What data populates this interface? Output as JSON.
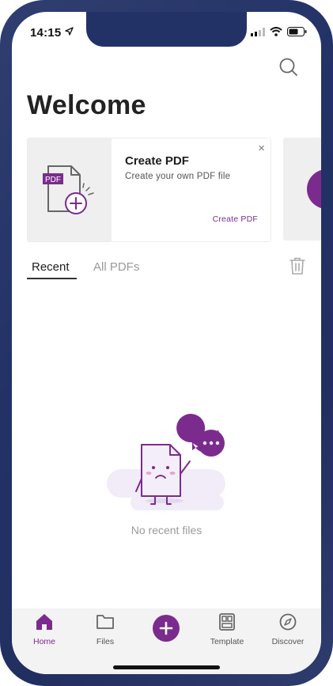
{
  "status": {
    "time": "14:15"
  },
  "page": {
    "title": "Welcome"
  },
  "card": {
    "title": "Create PDF",
    "subtitle": "Create your own PDF file",
    "link": "Create PDF",
    "close": "×",
    "icon_label": "PDF"
  },
  "tabs": [
    {
      "label": "Recent",
      "active": true
    },
    {
      "label": "All PDFs",
      "active": false
    }
  ],
  "empty": {
    "text": "No recent files"
  },
  "bottom_nav": [
    {
      "label": "Home",
      "icon": "home-icon",
      "active": true
    },
    {
      "label": "Files",
      "icon": "folder-icon",
      "active": false
    },
    {
      "label": "",
      "icon": "plus-icon",
      "active": false
    },
    {
      "label": "Template",
      "icon": "template-icon",
      "active": false
    },
    {
      "label": "Discover",
      "icon": "compass-icon",
      "active": false
    }
  ],
  "colors": {
    "accent": "#7b2b8e",
    "frame": "#233266",
    "tabbar": "#f3f3f3"
  }
}
